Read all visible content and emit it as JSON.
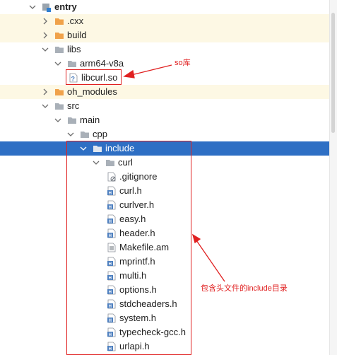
{
  "tree": {
    "rows": [
      {
        "label": "entry",
        "type": "module",
        "depth": 0,
        "arrow": "open",
        "bold": true,
        "excluded": false,
        "selected": false
      },
      {
        "label": ".cxx",
        "type": "folder-orange",
        "depth": 1,
        "arrow": "closed",
        "bold": false,
        "excluded": true,
        "selected": false
      },
      {
        "label": "build",
        "type": "folder-orange",
        "depth": 1,
        "arrow": "closed",
        "bold": false,
        "excluded": true,
        "selected": false
      },
      {
        "label": "libs",
        "type": "folder-gray",
        "depth": 1,
        "arrow": "open",
        "bold": false,
        "excluded": false,
        "selected": false
      },
      {
        "label": "arm64-v8a",
        "type": "folder-gray",
        "depth": 2,
        "arrow": "open",
        "bold": false,
        "excluded": false,
        "selected": false
      },
      {
        "label": "libcurl.so",
        "type": "file-unknown",
        "depth": 3,
        "arrow": "none",
        "bold": false,
        "excluded": false,
        "selected": false
      },
      {
        "label": "oh_modules",
        "type": "folder-orange",
        "depth": 1,
        "arrow": "closed",
        "bold": false,
        "excluded": true,
        "selected": false
      },
      {
        "label": "src",
        "type": "folder-gray",
        "depth": 1,
        "arrow": "open",
        "bold": false,
        "excluded": false,
        "selected": false
      },
      {
        "label": "main",
        "type": "folder-gray",
        "depth": 2,
        "arrow": "open",
        "bold": false,
        "excluded": false,
        "selected": false
      },
      {
        "label": "cpp",
        "type": "folder-gray",
        "depth": 3,
        "arrow": "open",
        "bold": false,
        "excluded": false,
        "selected": false
      },
      {
        "label": "include",
        "type": "folder-gray",
        "depth": 4,
        "arrow": "open",
        "bold": false,
        "excluded": false,
        "selected": true
      },
      {
        "label": "curl",
        "type": "folder-gray",
        "depth": 5,
        "arrow": "open",
        "bold": false,
        "excluded": false,
        "selected": false
      },
      {
        "label": ".gitignore",
        "type": "file-ignore",
        "depth": 6,
        "arrow": "none",
        "bold": false,
        "excluded": false,
        "selected": false
      },
      {
        "label": "curl.h",
        "type": "file-h",
        "depth": 6,
        "arrow": "none",
        "bold": false,
        "excluded": false,
        "selected": false
      },
      {
        "label": "curlver.h",
        "type": "file-h",
        "depth": 6,
        "arrow": "none",
        "bold": false,
        "excluded": false,
        "selected": false
      },
      {
        "label": "easy.h",
        "type": "file-h",
        "depth": 6,
        "arrow": "none",
        "bold": false,
        "excluded": false,
        "selected": false
      },
      {
        "label": "header.h",
        "type": "file-h",
        "depth": 6,
        "arrow": "none",
        "bold": false,
        "excluded": false,
        "selected": false
      },
      {
        "label": "Makefile.am",
        "type": "file-text",
        "depth": 6,
        "arrow": "none",
        "bold": false,
        "excluded": false,
        "selected": false
      },
      {
        "label": "mprintf.h",
        "type": "file-h",
        "depth": 6,
        "arrow": "none",
        "bold": false,
        "excluded": false,
        "selected": false
      },
      {
        "label": "multi.h",
        "type": "file-h",
        "depth": 6,
        "arrow": "none",
        "bold": false,
        "excluded": false,
        "selected": false
      },
      {
        "label": "options.h",
        "type": "file-h",
        "depth": 6,
        "arrow": "none",
        "bold": false,
        "excluded": false,
        "selected": false
      },
      {
        "label": "stdcheaders.h",
        "type": "file-h",
        "depth": 6,
        "arrow": "none",
        "bold": false,
        "excluded": false,
        "selected": false
      },
      {
        "label": "system.h",
        "type": "file-h",
        "depth": 6,
        "arrow": "none",
        "bold": false,
        "excluded": false,
        "selected": false
      },
      {
        "label": "typecheck-gcc.h",
        "type": "file-h",
        "depth": 6,
        "arrow": "none",
        "bold": false,
        "excluded": false,
        "selected": false
      },
      {
        "label": "urlapi.h",
        "type": "file-h",
        "depth": 6,
        "arrow": "none",
        "bold": false,
        "excluded": false,
        "selected": false
      }
    ]
  },
  "annotations": {
    "so_label": "so库",
    "include_label": "包含头文件的include目录"
  },
  "colors": {
    "selection": "#2e6fc4",
    "excluded_row": "#fdf8e4",
    "folder_orange": "#f0a24a",
    "folder_gray": "#a9b0b8",
    "annotation": "#e02020",
    "header_icon": "#4d7fbf"
  }
}
